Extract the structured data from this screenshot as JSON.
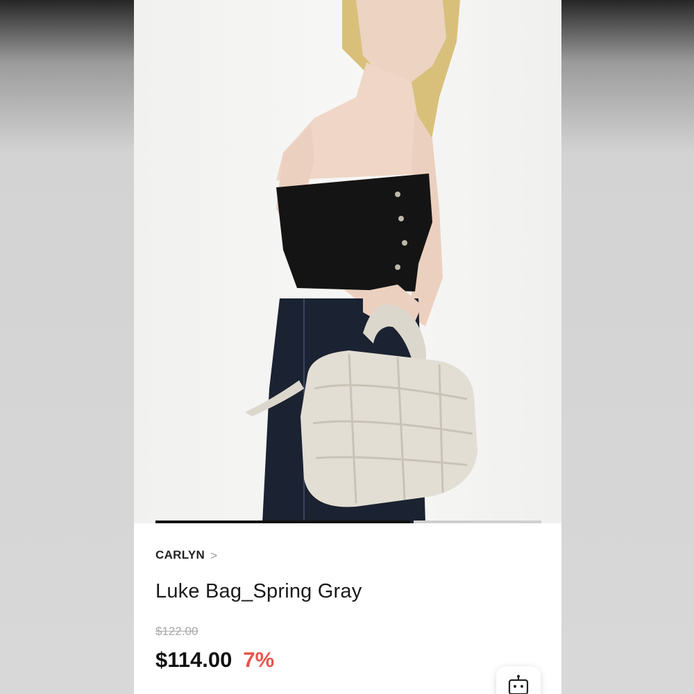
{
  "product": {
    "brand": "CARLYN",
    "brand_chevron": ">",
    "title": "Luke Bag_Spring Gray",
    "original_price": "$122.00",
    "sale_price": "$114.00",
    "discount": "7%"
  },
  "gallery": {
    "image_description_icon": "product-photo",
    "progress_fraction": 0.66
  },
  "actions": {
    "chat_icon": "chatbot-icon"
  },
  "colors": {
    "discount": "#e8554e",
    "text_primary": "#111111",
    "strikethrough": "#a8a8a8"
  }
}
